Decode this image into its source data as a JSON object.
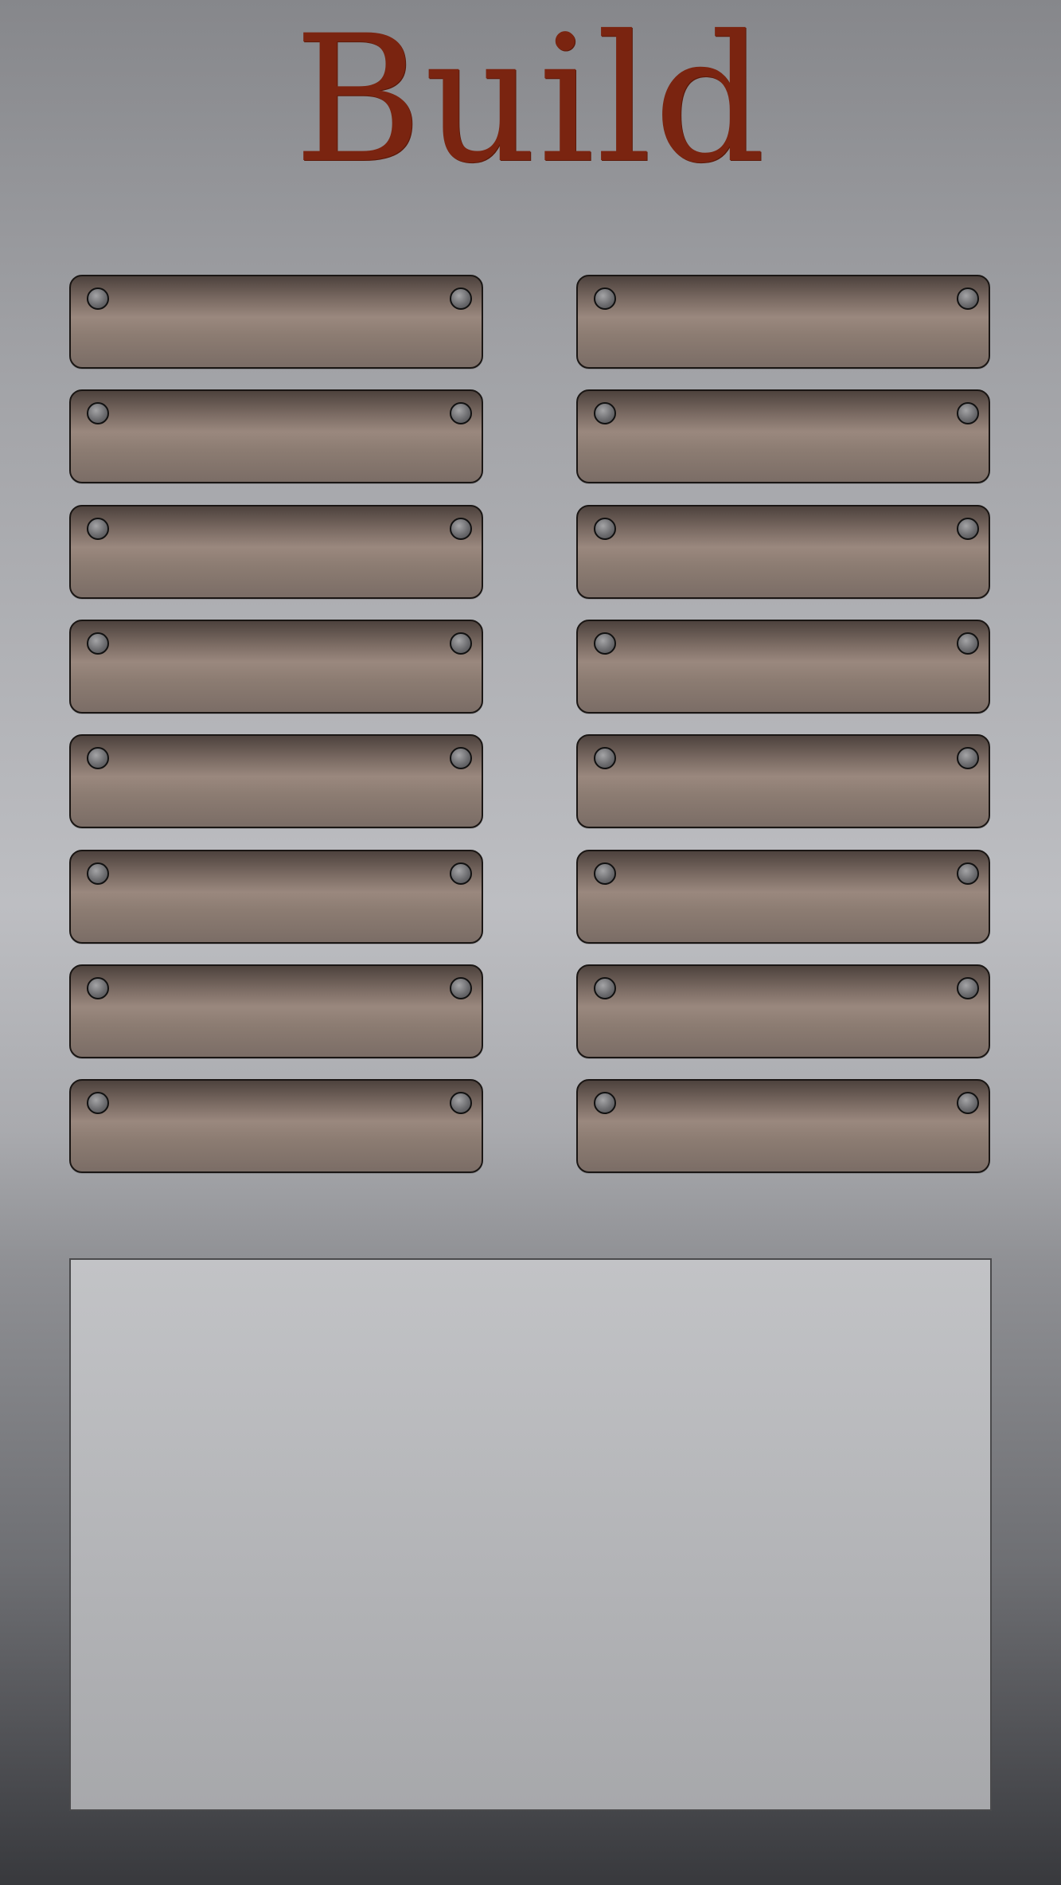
{
  "title": "Build",
  "colors": {
    "title": "#7a2410",
    "plate": "#8c7c72",
    "panel": "#b5b6b9"
  },
  "build_slots": {
    "columns": 2,
    "rows": 8,
    "count": 16,
    "icon": "rivet-icon"
  },
  "info_panel": {}
}
